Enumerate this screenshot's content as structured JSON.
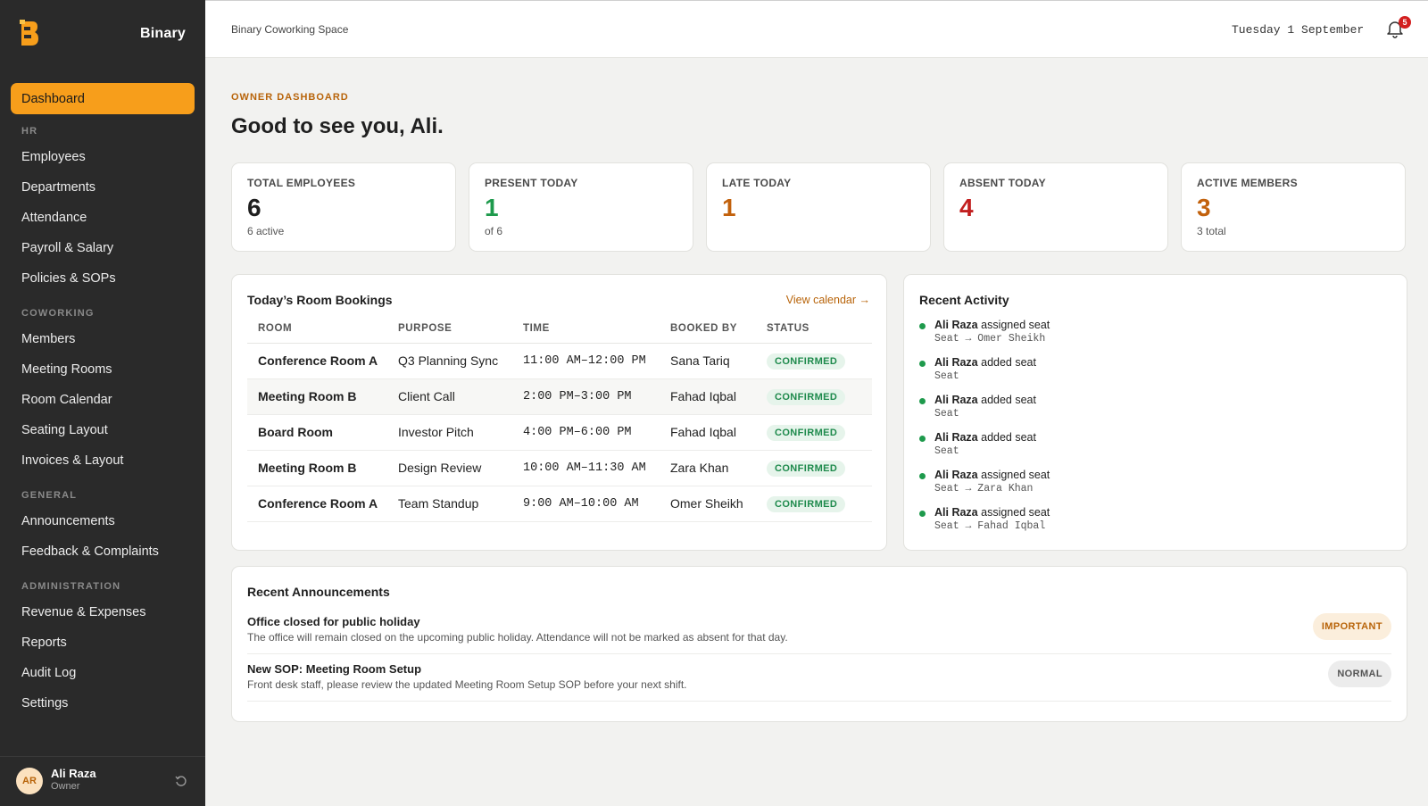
{
  "app": {
    "name": "Binary"
  },
  "sidebar": {
    "active": "Dashboard",
    "sections": [
      {
        "title": "HR",
        "items": [
          "Employees",
          "Departments",
          "Attendance",
          "Payroll & Salary",
          "Policies & SOPs"
        ]
      },
      {
        "title": "COWORKING",
        "items": [
          "Members",
          "Meeting Rooms",
          "Room Calendar",
          "Seating Layout",
          "Invoices & Layout"
        ]
      },
      {
        "title": "GENERAL",
        "items": [
          "Announcements",
          "Feedback & Complaints"
        ]
      },
      {
        "title": "ADMINISTRATION",
        "items": [
          "Revenue & Expenses",
          "Reports",
          "Audit Log",
          "Settings"
        ]
      }
    ],
    "user": {
      "initials": "AR",
      "name": "Ali Raza",
      "role": "Owner"
    }
  },
  "header": {
    "workspace": "Binary Coworking Space",
    "date": "Tuesday 1 September",
    "notification_count": "5"
  },
  "page": {
    "eyebrow": "OWNER DASHBOARD",
    "greeting": "Good to see you, Ali."
  },
  "stats": [
    {
      "label": "TOTAL EMPLOYEES",
      "value": "6",
      "sub": "6 active",
      "color": "#1f1f1f"
    },
    {
      "label": "PRESENT TODAY",
      "value": "1",
      "sub": "of 6",
      "color": "#1e9a4c"
    },
    {
      "label": "LATE TODAY",
      "value": "1",
      "sub": "",
      "color": "#c2610c"
    },
    {
      "label": "ABSENT TODAY",
      "value": "4",
      "sub": "",
      "color": "#c21f1f"
    },
    {
      "label": "ACTIVE MEMBERS",
      "value": "3",
      "sub": "3 total",
      "color": "#c2610c"
    }
  ],
  "bookings": {
    "title": "Today’s Room Bookings",
    "view_calendar": "View calendar →",
    "columns": [
      "ROOM",
      "PURPOSE",
      "TIME",
      "BOOKED BY",
      "STATUS"
    ],
    "rows": [
      {
        "room": "Conference Room A",
        "purpose": "Q3 Planning Sync",
        "time": "11:00 AM–12:00 PM",
        "booked_by": "Sana Tariq",
        "status": "CONFIRMED"
      },
      {
        "room": "Meeting Room B",
        "purpose": "Client Call",
        "time": "2:00 PM–3:00 PM",
        "booked_by": "Fahad Iqbal",
        "status": "CONFIRMED"
      },
      {
        "room": "Board Room",
        "purpose": "Investor Pitch",
        "time": "4:00 PM–6:00 PM",
        "booked_by": "Fahad Iqbal",
        "status": "CONFIRMED"
      },
      {
        "room": "Meeting Room B",
        "purpose": "Design Review",
        "time": "10:00 AM–11:30 AM",
        "booked_by": "Zara Khan",
        "status": "CONFIRMED"
      },
      {
        "room": "Conference Room A",
        "purpose": "Team Standup",
        "time": "9:00 AM–10:00 AM",
        "booked_by": "Omer Sheikh",
        "status": "CONFIRMED"
      }
    ]
  },
  "activity": {
    "title": "Recent Activity",
    "items": [
      {
        "actor": "Ali Raza",
        "action": "assigned seat",
        "detail": "Seat → Omer Sheikh"
      },
      {
        "actor": "Ali Raza",
        "action": "added seat",
        "detail": "Seat"
      },
      {
        "actor": "Ali Raza",
        "action": "added seat",
        "detail": "Seat"
      },
      {
        "actor": "Ali Raza",
        "action": "added seat",
        "detail": "Seat"
      },
      {
        "actor": "Ali Raza",
        "action": "assigned seat",
        "detail": "Seat → Zara Khan"
      },
      {
        "actor": "Ali Raza",
        "action": "assigned seat",
        "detail": "Seat → Fahad Iqbal"
      }
    ]
  },
  "announcements": {
    "title": "Recent Announcements",
    "items": [
      {
        "title": "Office closed for public holiday",
        "body": "The office will remain closed on the upcoming public holiday. Attendance will not be marked as absent for that day.",
        "priority": "IMPORTANT"
      },
      {
        "title": "New SOP: Meeting Room Setup",
        "body": "Front desk staff, please review the updated Meeting Room Setup SOP before your next shift.",
        "priority": "NORMAL"
      }
    ]
  },
  "colors": {
    "accent": "#f79e1b",
    "sidebar_bg": "#2a2a2a",
    "success": "#1e9a4c",
    "danger": "#c21f1f"
  }
}
